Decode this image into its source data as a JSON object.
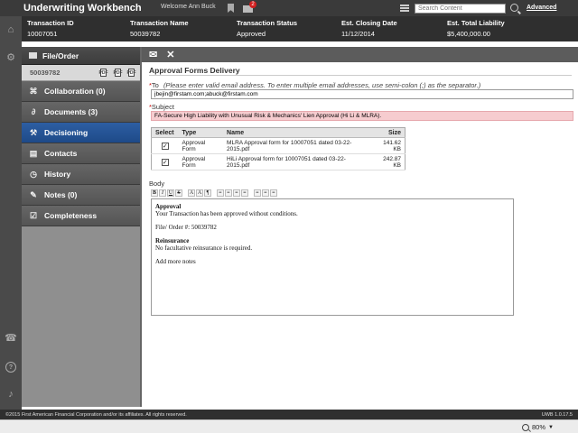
{
  "app": {
    "title": "Underwriting Workbench",
    "welcome": "Welcome Ann Buck",
    "notification_count": "2",
    "search_placeholder": "Search Content",
    "advanced_label": "Advanced"
  },
  "summary": [
    {
      "header": "Transaction ID",
      "value": "10007051"
    },
    {
      "header": "Transaction Name",
      "value": "50039782"
    },
    {
      "header": "Transaction Status",
      "value": "Approved"
    },
    {
      "header": "Est. Closing Date",
      "value": "11/12/2014"
    },
    {
      "header": "Est. Total Liability",
      "value": "$5,400,000.00"
    }
  ],
  "nav": {
    "file_header": "File/Order",
    "file_number": "50039782",
    "pdf_label": "PDF",
    "items": [
      {
        "label": "Collaboration (0)",
        "icon": "collaboration-icon"
      },
      {
        "label": "Documents (3)",
        "icon": "paperclip-icon"
      },
      {
        "label": "Decisioning",
        "icon": "gavel-icon",
        "active": true
      },
      {
        "label": "Contacts",
        "icon": "contacts-icon"
      },
      {
        "label": "History",
        "icon": "clock-icon"
      },
      {
        "label": "Notes (0)",
        "icon": "pencil-icon"
      },
      {
        "label": "Completeness",
        "icon": "checklist-icon"
      }
    ]
  },
  "form": {
    "title": "Approval Forms Delivery",
    "to_label": "To",
    "to_hint": "(Please enter valid email address. To enter multiple email addresses, use semi-colon (;) as the separator.)",
    "to_value": "jbejin@firstam.com;abuck@firstam.com",
    "subject_label": "Subject",
    "subject_value": "FA-Secure High Liability with Unusual Risk & Mechanics' Lien Approval (Hi Li & MLRA).",
    "table_headers": {
      "select": "Select",
      "type": "Type",
      "name": "Name",
      "size": "Size"
    },
    "attachments": [
      {
        "checked": true,
        "check_mark": "✓",
        "type": "Approval Form",
        "name": "MLRA Approval form for 10007051 dated 03-22-2015.pdf",
        "size": "141.62 KB"
      },
      {
        "checked": true,
        "check_mark": "✓",
        "type": "Approval Form",
        "name": "HiLi Approval form for 10007051 dated 03-22-2015.pdf",
        "size": "242.87 KB"
      }
    ],
    "body_label": "Body",
    "body": {
      "approval_heading": "Approval",
      "approval_text": "Your Transaction has been approved without conditions.",
      "file_order": "File/ Order #: 50039782",
      "reinsurance_heading": "Reinsurance",
      "reinsurance_text": "No facultative reinsurance is required.",
      "more": "Add more notes"
    }
  },
  "footer": {
    "copyright": "©2015 First American Financial Corporation and/or its affiliates. All rights reserved.",
    "version": "UWB 1.0.17.5"
  },
  "status": {
    "zoom": "80%"
  }
}
